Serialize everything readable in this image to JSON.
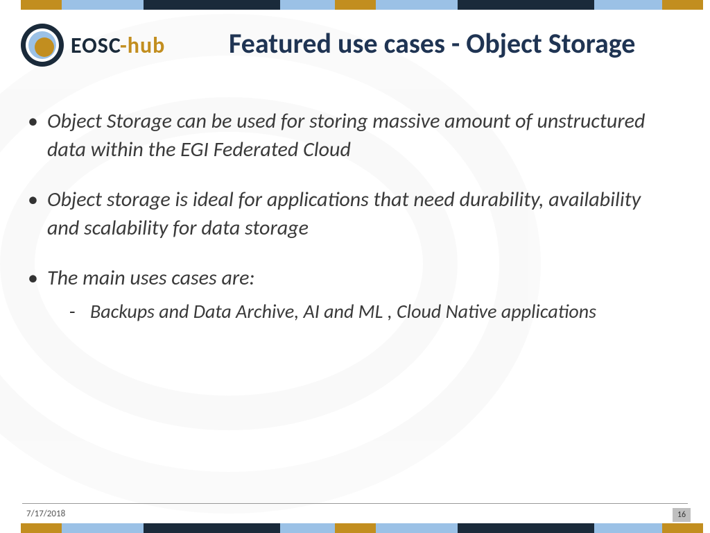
{
  "logo": {
    "text_main": "EOSC",
    "text_dash": "-",
    "text_sub": "hub"
  },
  "title": "Featured use cases - Object Storage",
  "bullets": [
    {
      "text": "Object Storage can be used for storing  massive amount of unstructured data  within the EGI Federated Cloud"
    },
    {
      "text": "Object storage is ideal for applications that need durability, availability and scalability for data storage"
    },
    {
      "text": "The main uses cases are:",
      "sub": [
        {
          "text": "Backups and Data Archive, AI and ML , Cloud Native applications"
        }
      ]
    }
  ],
  "footer": {
    "date": "7/17/2018",
    "page": "16"
  },
  "bar_segments": [
    {
      "color": "gold",
      "w": "6%"
    },
    {
      "color": "lblue",
      "w": "12%"
    },
    {
      "color": "navy",
      "w": "20%"
    },
    {
      "color": "lblue",
      "w": "8%"
    },
    {
      "color": "gold",
      "w": "6%"
    },
    {
      "color": "lblue",
      "w": "12%"
    },
    {
      "color": "navy",
      "w": "20%"
    },
    {
      "color": "lblue",
      "w": "10%"
    },
    {
      "color": "gold",
      "w": "6%"
    }
  ]
}
